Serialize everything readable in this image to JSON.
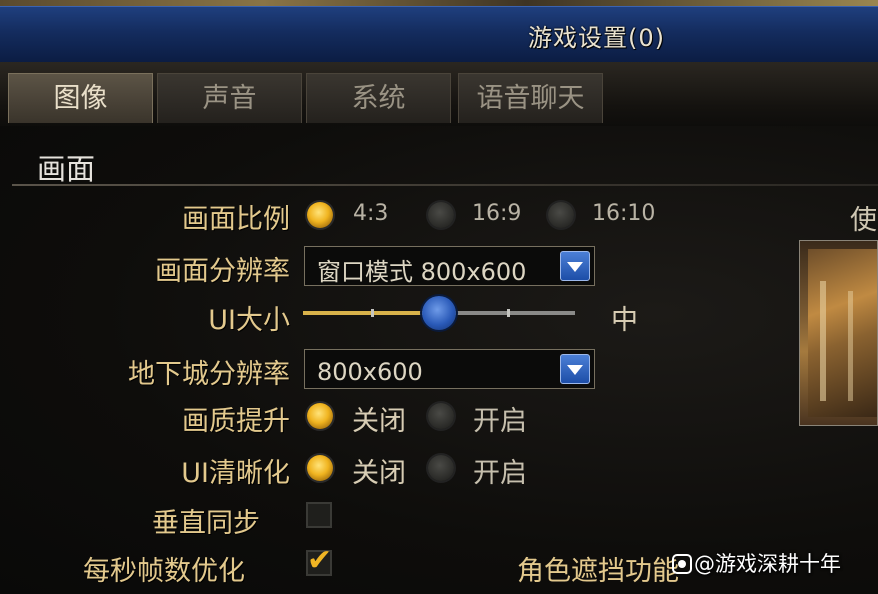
{
  "window": {
    "title": "游戏设置(0)"
  },
  "tabs": [
    {
      "label": "图像",
      "active": true
    },
    {
      "label": "声音",
      "active": false
    },
    {
      "label": "系统",
      "active": false
    },
    {
      "label": "语音聊天",
      "active": false
    }
  ],
  "section": {
    "title": "画面"
  },
  "settings": {
    "aspect_ratio": {
      "label": "画面比例",
      "options": [
        "4:3",
        "16:9",
        "16:10"
      ],
      "selected": "4:3"
    },
    "resolution": {
      "label": "画面分辨率",
      "value": "窗口模式 800x600"
    },
    "ui_size": {
      "label": "UI大小",
      "value_text": "中",
      "level": 0.5
    },
    "dungeon_resolution": {
      "label": "地下城分辨率",
      "value": "800x600"
    },
    "quality_boost": {
      "label": "画质提升",
      "options": [
        "关闭",
        "开启"
      ],
      "selected": "关闭"
    },
    "ui_sharpen": {
      "label": "UI清晰化",
      "options": [
        "关闭",
        "开启"
      ],
      "selected": "关闭"
    },
    "vsync": {
      "label": "垂直同步",
      "checked": false
    },
    "fps_optimize": {
      "label": "每秒帧数优化",
      "checked": true
    },
    "character_occlusion": {
      "label": "角色遮挡功能"
    }
  },
  "preview": {
    "partial_label": "使"
  },
  "watermark": {
    "text": "@游戏深耕十年"
  },
  "colors": {
    "titlebar": "#142c5e",
    "label_gold": "#e3c98d",
    "radio_on": "#f0b420",
    "dropdown_arrow": "#1d4ea8",
    "slider_knob": "#2a5ab8"
  }
}
